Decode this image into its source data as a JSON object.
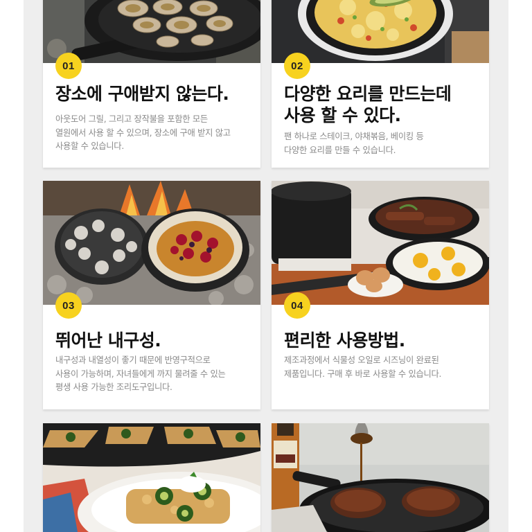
{
  "cards": [
    {
      "number": "01",
      "title_lines": [
        "장소에 구애받지 않는다."
      ],
      "desc_lines": [
        "아웃도어 그릴, 그리고 장작불을 포함한 모든",
        "열원에서 사용 할 수 있으며, 장소에 구애 받지 않고",
        "사용할 수 있습니다."
      ],
      "image_icon": "oysters-skillet-image"
    },
    {
      "number": "02",
      "title_lines": [
        "다양한 요리를 만드는데",
        "사용 할 수 있다."
      ],
      "desc_lines": [
        "팬 하나로 스테이크, 야채볶음, 베이킹 등",
        "다양한 요리를 만들 수 있습니다."
      ],
      "image_icon": "scrambled-eggs-skillet-image"
    },
    {
      "number": "03",
      "title_lines": [
        "뛰어난 내구성."
      ],
      "desc_lines": [
        "내구성과 내열성이 좋기 때문에 반영구적으로",
        "사용이 가능하며, 자녀들에게 까지 물려줄 수 있는",
        "평생 사용 가능한 조리도구입니다."
      ],
      "image_icon": "campfire-dutch-oven-image"
    },
    {
      "number": "04",
      "title_lines": [
        "편리한 사용방법."
      ],
      "desc_lines": [
        "제조과정에서 식물성 오일로 시즈닝이 완료된",
        "제품입니다. 구매 후 바로 사용할 수 있습니다."
      ],
      "image_icon": "stovetop-skillets-image"
    },
    {
      "image_icon": "cornbread-pan-image"
    },
    {
      "image_icon": "steak-syrup-skillet-image"
    }
  ],
  "colors": {
    "badge": "#f7d21f",
    "page_background": "#eeeeee",
    "card_background": "#ffffff",
    "title": "#111111",
    "description": "#8a8a8a"
  }
}
